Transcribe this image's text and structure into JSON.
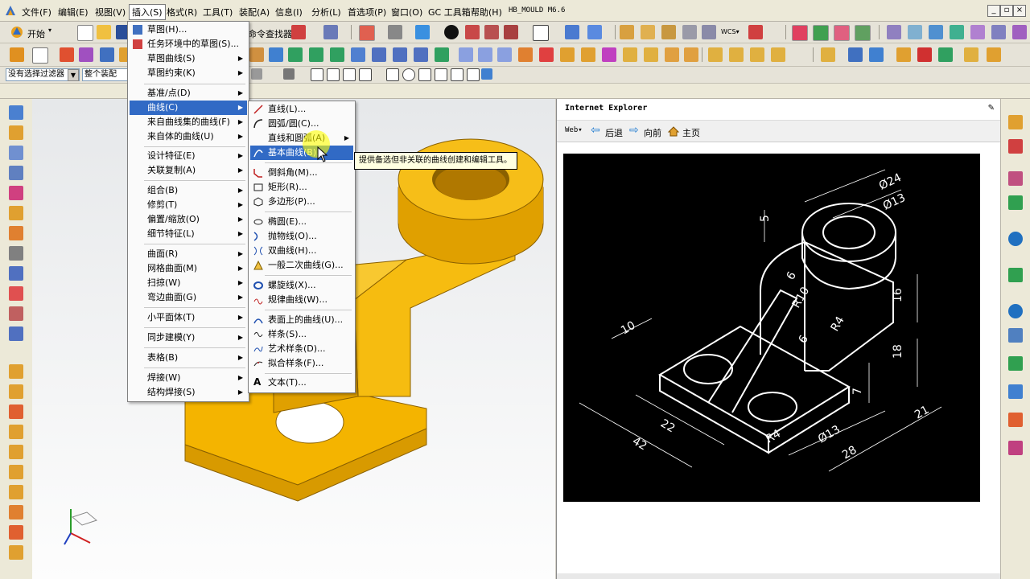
{
  "menubar": {
    "items": [
      "文件(F)",
      "编辑(E)",
      "视图(V)",
      "插入(S)",
      "格式(R)",
      "工具(T)",
      "装配(A)",
      "信息(I)",
      "分析(L)",
      "首选项(P)",
      "窗口(O)",
      "GC 工具箱",
      "帮助(H)",
      "HB_MOULD M6.6"
    ],
    "active_index": 3
  },
  "toolbar": {
    "start_label": "开始",
    "command_finder_label": "命令查找器",
    "filter_value": "没有选择过滤器",
    "assembly_value": "整个装配"
  },
  "insert_menu": {
    "items": [
      {
        "label": "草图(H)...",
        "icon": "sketch-icon"
      },
      {
        "label": "任务环境中的草图(S)...",
        "icon": "task-sketch-icon"
      },
      {
        "label": "草图曲线(S)",
        "submenu": true
      },
      {
        "label": "草图约束(K)",
        "submenu": true
      },
      {
        "label": "基准/点(D)",
        "submenu": true
      },
      {
        "label": "曲线(C)",
        "submenu": true,
        "highlighted": true
      },
      {
        "label": "来自曲线集的曲线(F)",
        "submenu": true
      },
      {
        "label": "来自体的曲线(U)",
        "submenu": true
      },
      {
        "label": "设计特征(E)",
        "submenu": true
      },
      {
        "label": "关联复制(A)",
        "submenu": true
      },
      {
        "label": "组合(B)",
        "submenu": true
      },
      {
        "label": "修剪(T)",
        "submenu": true
      },
      {
        "label": "偏置/缩放(O)",
        "submenu": true
      },
      {
        "label": "细节特征(L)",
        "submenu": true
      },
      {
        "label": "曲面(R)",
        "submenu": true
      },
      {
        "label": "网格曲面(M)",
        "submenu": true
      },
      {
        "label": "扫掠(W)",
        "submenu": true
      },
      {
        "label": "弯边曲面(G)",
        "submenu": true
      },
      {
        "label": "小平面体(T)",
        "submenu": true
      },
      {
        "label": "同步建模(Y)",
        "submenu": true
      },
      {
        "label": "表格(B)",
        "submenu": true
      },
      {
        "label": "焊接(W)",
        "submenu": true
      },
      {
        "label": "结构焊接(S)",
        "submenu": true
      }
    ]
  },
  "curve_menu": {
    "items": [
      {
        "label": "直线(L)...",
        "icon": "line-icon"
      },
      {
        "label": "圆弧/圆(C)...",
        "icon": "arc-icon"
      },
      {
        "label": "直线和圆弧(A)",
        "icon": "",
        "submenu": true
      },
      {
        "label": "基本曲线(B)...",
        "icon": "basic-curve-icon",
        "highlighted": true
      },
      {
        "label": "倒斜角(M)...",
        "icon": "chamfer-icon"
      },
      {
        "label": "矩形(R)...",
        "icon": "rectangle-icon"
      },
      {
        "label": "多边形(P)...",
        "icon": "polygon-icon"
      },
      {
        "label": "椭圆(E)...",
        "icon": "ellipse-icon"
      },
      {
        "label": "抛物线(O)...",
        "icon": "parabola-icon"
      },
      {
        "label": "双曲线(H)...",
        "icon": "hyperbola-icon"
      },
      {
        "label": "一般二次曲线(G)...",
        "icon": "conic-icon"
      },
      {
        "label": "螺旋线(X)...",
        "icon": "helix-icon"
      },
      {
        "label": "规律曲线(W)...",
        "icon": "law-curve-icon"
      },
      {
        "label": "表面上的曲线(U)...",
        "icon": "curve-on-surface-icon"
      },
      {
        "label": "样条(S)...",
        "icon": "spline-icon"
      },
      {
        "label": "艺术样条(D)...",
        "icon": "studio-spline-icon"
      },
      {
        "label": "拟合样条(F)...",
        "icon": "fit-spline-icon"
      },
      {
        "label": "文本(T)...",
        "icon": "text-icon"
      }
    ]
  },
  "tooltip": "提供备选但非关联的曲线创建和编辑工具。",
  "ie": {
    "title": "Internet Explorer",
    "web_label": "Web",
    "back_label": "后退",
    "forward_label": "向前",
    "home_label": "主页"
  },
  "drawing": {
    "dims": [
      "Ø24",
      "Ø13",
      "5",
      "6",
      "R10",
      "16",
      "R4",
      "6",
      "10",
      "18",
      "7",
      "22",
      "42",
      "R4",
      "Ø13",
      "21",
      "28"
    ]
  }
}
